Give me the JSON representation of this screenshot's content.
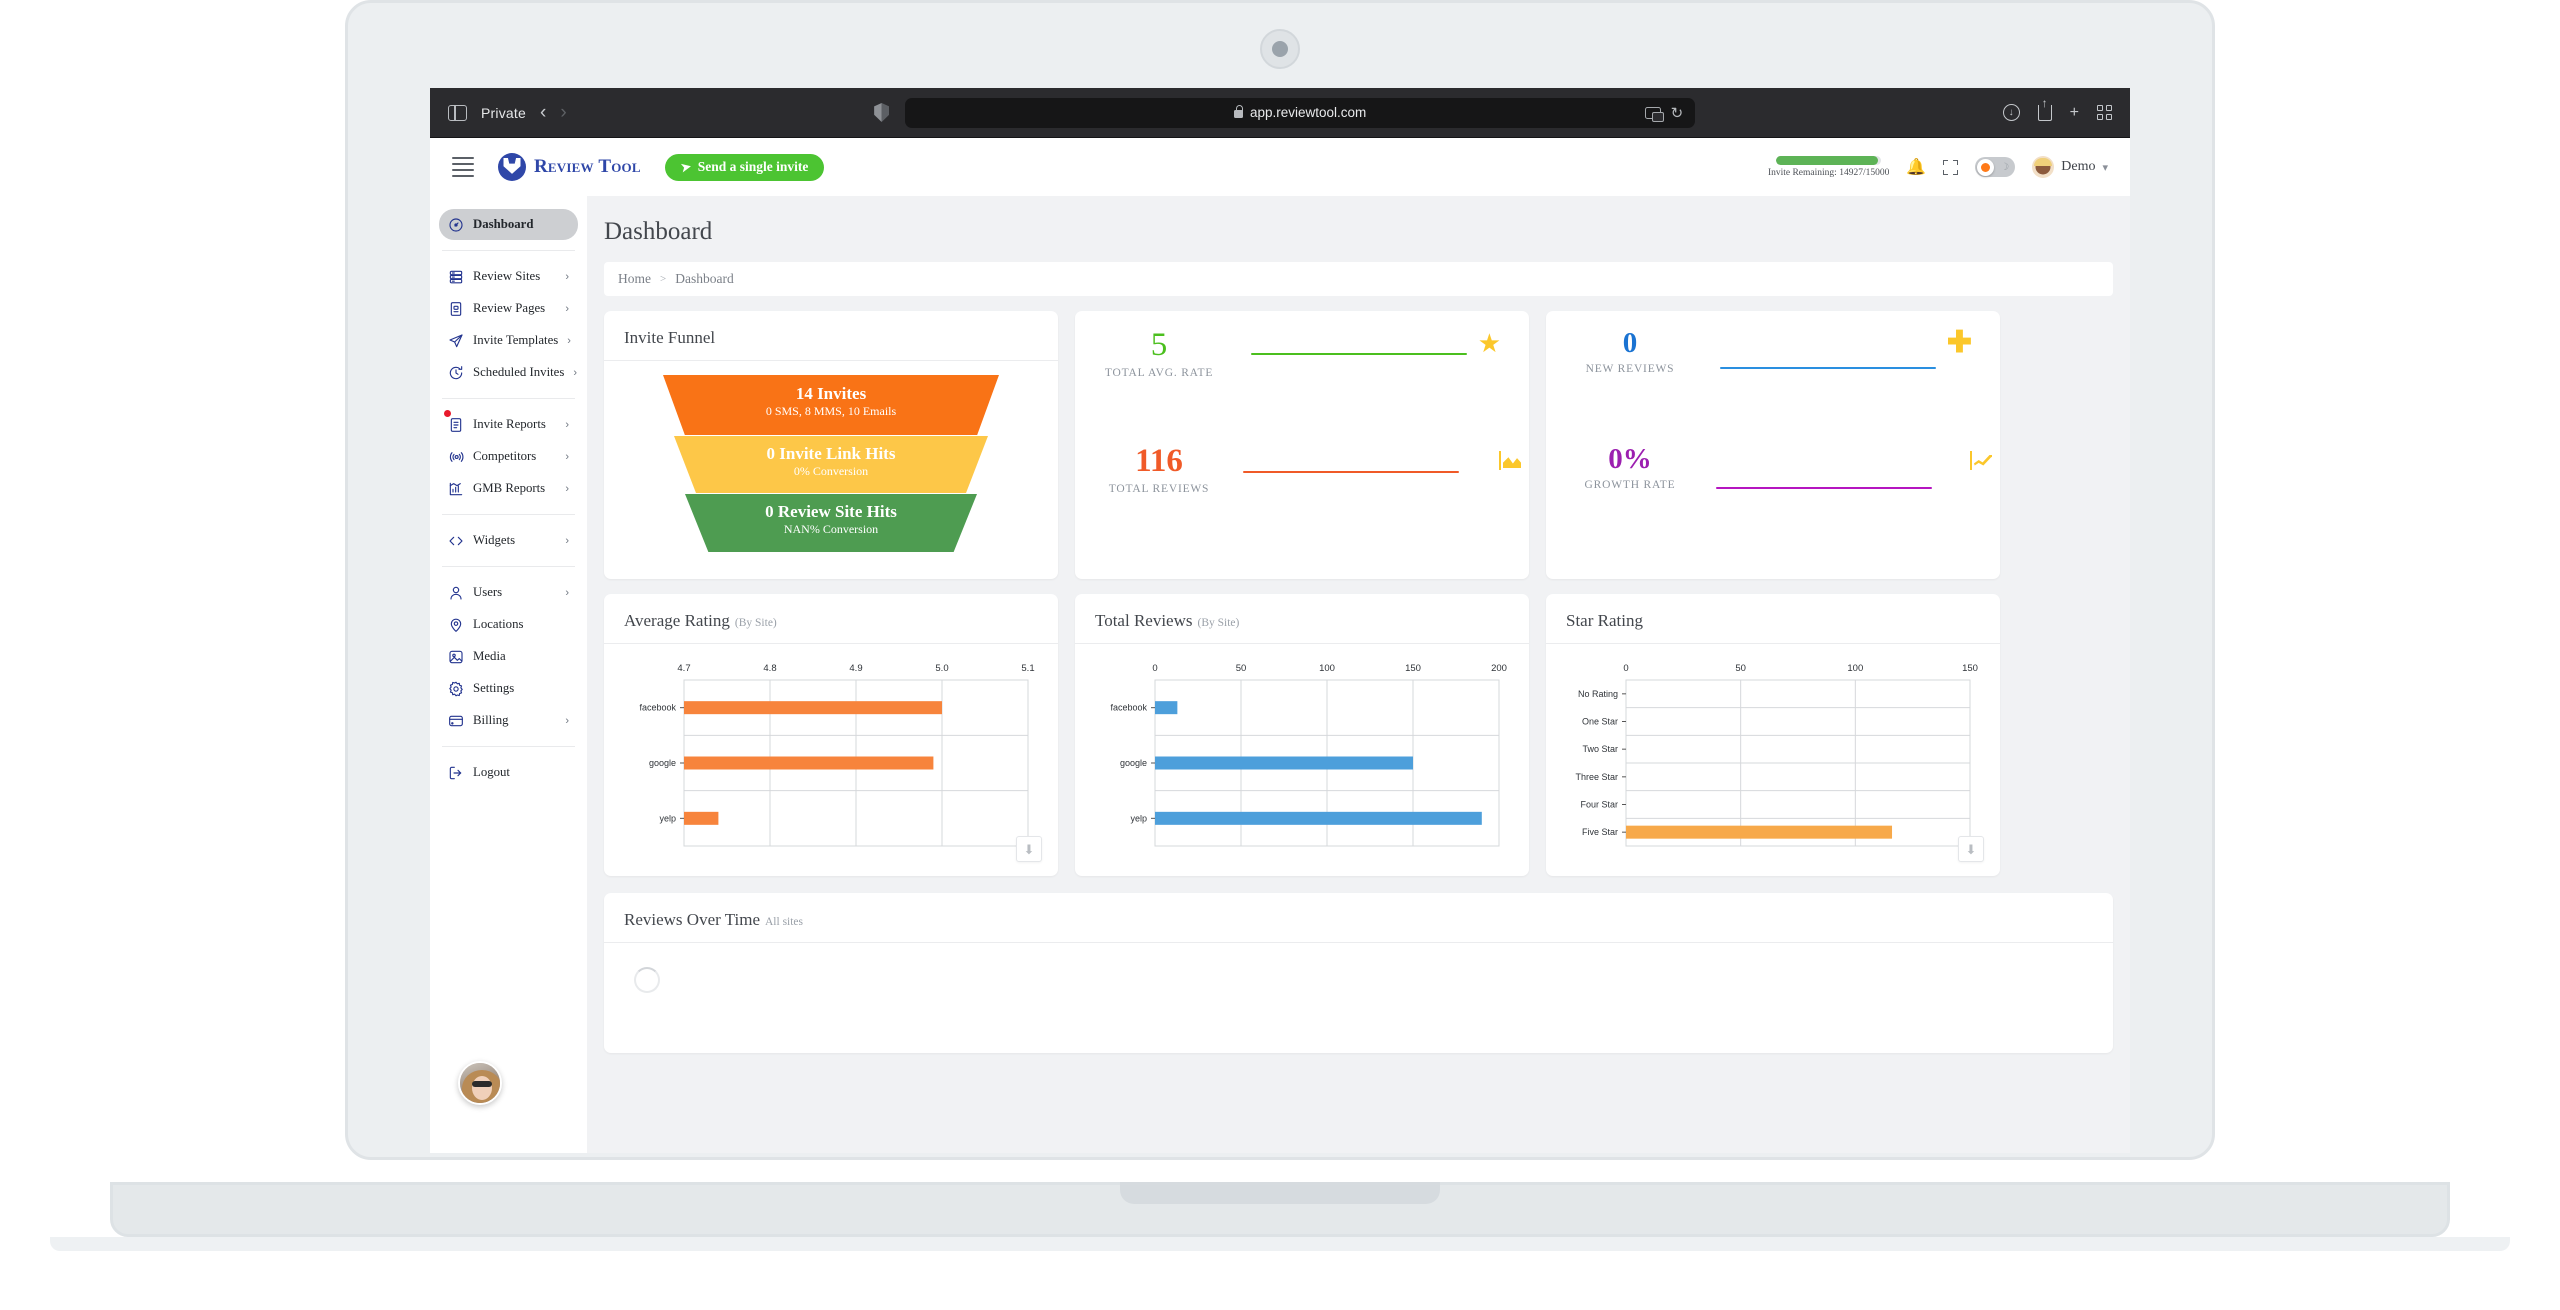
{
  "browser": {
    "private_label": "Private",
    "back_icon": "chevron-left",
    "forward_icon": "chevron-right",
    "url": "app.reviewtool.com",
    "lock_icon": "lock-icon",
    "shield_icon": "shield-icon",
    "translate_icon": "translate-icon",
    "reload_icon": "reload-icon",
    "download_icon": "download-icon",
    "share_icon": "share-icon",
    "new_tab_icon": "plus-icon",
    "tab_overview_icon": "grid-icon"
  },
  "header": {
    "menu_icon": "hamburger-icon",
    "brand": "Review Tool",
    "invite_button": "Send a single invite",
    "invite_button_icon": "paper-plane-icon",
    "meter_label": "Invite Remaining:",
    "meter_value": "14927/15000",
    "meter_percent": 99.5,
    "bell_icon": "bell-icon",
    "fullscreen_icon": "fullscreen-icon",
    "theme_toggle": "light",
    "user_name": "Demo",
    "user_caret": "chevron-down-icon"
  },
  "sidebar": {
    "groups": [
      {
        "items": [
          {
            "label": "Dashboard",
            "icon": "gauge-icon",
            "active": true,
            "arrow": false
          }
        ]
      },
      {
        "items": [
          {
            "label": "Review Sites",
            "icon": "server-icon",
            "arrow": true
          },
          {
            "label": "Review Pages",
            "icon": "document-icon",
            "arrow": true
          },
          {
            "label": "Invite Templates",
            "icon": "paper-plane-icon",
            "arrow": true
          },
          {
            "label": "Scheduled Invites",
            "icon": "clock-refresh-icon",
            "arrow": true
          }
        ]
      },
      {
        "items": [
          {
            "label": "Invite Reports",
            "icon": "report-icon",
            "arrow": true,
            "badge": true
          },
          {
            "label": "Competitors",
            "icon": "radar-icon",
            "arrow": true
          },
          {
            "label": "GMB Reports",
            "icon": "bar-chart-icon",
            "arrow": true
          }
        ]
      },
      {
        "items": [
          {
            "label": "Widgets",
            "icon": "code-icon",
            "arrow": true
          }
        ]
      },
      {
        "items": [
          {
            "label": "Users",
            "icon": "user-icon",
            "arrow": true
          },
          {
            "label": "Locations",
            "icon": "map-pin-icon",
            "arrow": false
          },
          {
            "label": "Media",
            "icon": "image-icon",
            "arrow": false
          },
          {
            "label": "Settings",
            "icon": "gear-icon",
            "arrow": false
          },
          {
            "label": "Billing",
            "icon": "credit-card-icon",
            "arrow": true
          }
        ]
      },
      {
        "items": [
          {
            "label": "Logout",
            "icon": "logout-icon",
            "arrow": false
          }
        ]
      }
    ],
    "chat_avatar": "support-chat-avatar"
  },
  "page": {
    "title": "Dashboard",
    "breadcrumb": [
      "Home",
      "Dashboard"
    ],
    "breadcrumb_sep": ">"
  },
  "funnel": {
    "card_title": "Invite Funnel",
    "stages": [
      {
        "main": "14 Invites",
        "sub": "0 SMS, 8 MMS, 10 Emails",
        "color": "#f97316"
      },
      {
        "main": "0 Invite Link Hits",
        "sub": "0% Conversion",
        "color": "#fdc748"
      },
      {
        "main": "0 Review Site Hits",
        "sub": "NAN% Conversion",
        "color": "#4e9c51"
      }
    ]
  },
  "stats": [
    {
      "value": "5",
      "label": "TOTAL AVG. RATE",
      "color": "#4bbf1e",
      "icon": "star-icon"
    },
    {
      "value": "116",
      "label": "TOTAL REVIEWS",
      "color": "#f05a28",
      "icon": "area-chart-icon"
    },
    {
      "value": "0",
      "label": "NEW REVIEWS",
      "color": "#1a73d2",
      "icon": "plus-icon"
    },
    {
      "value": "0%",
      "label": "GROWTH RATE",
      "color": "#9c1fb0",
      "icon": "line-chart-icon"
    }
  ],
  "chart_data": [
    {
      "type": "bar",
      "orientation": "horizontal",
      "title": "Average Rating",
      "subtitle": "(By Site)",
      "categories": [
        "facebook",
        "google",
        "yelp"
      ],
      "values": [
        5.0,
        4.99,
        4.74
      ],
      "xticks": [
        "4.7",
        "4.8",
        "4.9",
        "5.0",
        "5.1"
      ],
      "xlim": [
        4.7,
        5.1
      ],
      "xlabel": "",
      "ylabel": "",
      "grid": true,
      "legend": "none",
      "bar_color": "#f7843c",
      "download_icon": "download-icon"
    },
    {
      "type": "bar",
      "orientation": "horizontal",
      "title": "Total Reviews",
      "subtitle": "(By Site)",
      "categories": [
        "facebook",
        "google",
        "yelp"
      ],
      "values": [
        13,
        150,
        190
      ],
      "xticks": [
        "0",
        "50",
        "100",
        "150",
        "200"
      ],
      "xlim": [
        0,
        200
      ],
      "xlabel": "",
      "ylabel": "",
      "grid": true,
      "legend": "none",
      "bar_color": "#4d9fdb"
    },
    {
      "type": "bar",
      "orientation": "horizontal",
      "title": "Star Rating",
      "subtitle": "",
      "categories": [
        "No Rating",
        "One Star",
        "Two Star",
        "Three Star",
        "Four Star",
        "Five Star"
      ],
      "values": [
        0,
        0,
        0,
        0,
        0,
        116
      ],
      "xticks": [
        "0",
        "50",
        "100",
        "150"
      ],
      "xlim": [
        0,
        150
      ],
      "xlabel": "",
      "ylabel": "",
      "grid": true,
      "legend": "none",
      "bar_color": "#f7a94a",
      "download_icon": "download-icon"
    }
  ],
  "reviews_over_time": {
    "title": "Reviews Over Time",
    "subtitle": "All sites",
    "state": "loading"
  }
}
